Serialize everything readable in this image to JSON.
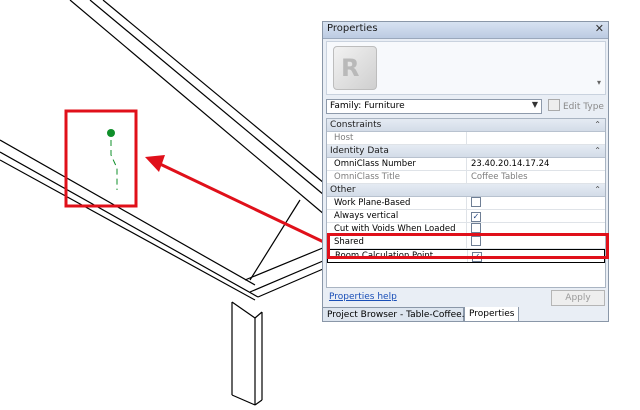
{
  "panel": {
    "title": "Properties",
    "close_icon": "close-icon",
    "family_selector": "Family: Furniture",
    "edit_type_label": "Edit Type",
    "apply_label": "Apply",
    "help_link": "Properties help"
  },
  "categories": [
    {
      "label": "Constraints",
      "rows": [
        {
          "name": "Host",
          "value": "",
          "gray": true
        }
      ]
    },
    {
      "label": "Identity Data",
      "rows": [
        {
          "name": "OmniClass Number",
          "value": "23.40.20.14.17.24",
          "gray": false
        },
        {
          "name": "OmniClass Title",
          "value": "Coffee Tables",
          "gray": true
        }
      ]
    },
    {
      "label": "Other",
      "rows": [
        {
          "name": "Work Plane-Based",
          "check": false
        },
        {
          "name": "Always vertical",
          "check": true
        },
        {
          "name": "Cut with Voids When Loaded",
          "check": false
        },
        {
          "name": "Shared",
          "check": false
        },
        {
          "name": "Room Calculation Point",
          "check": true
        }
      ]
    }
  ],
  "tabs": {
    "project_browser": "Project Browser - Table-Coffee.rfa",
    "properties": "Properties"
  },
  "colors": {
    "highlight": "#e0101a",
    "point": "#0f8f2a"
  }
}
